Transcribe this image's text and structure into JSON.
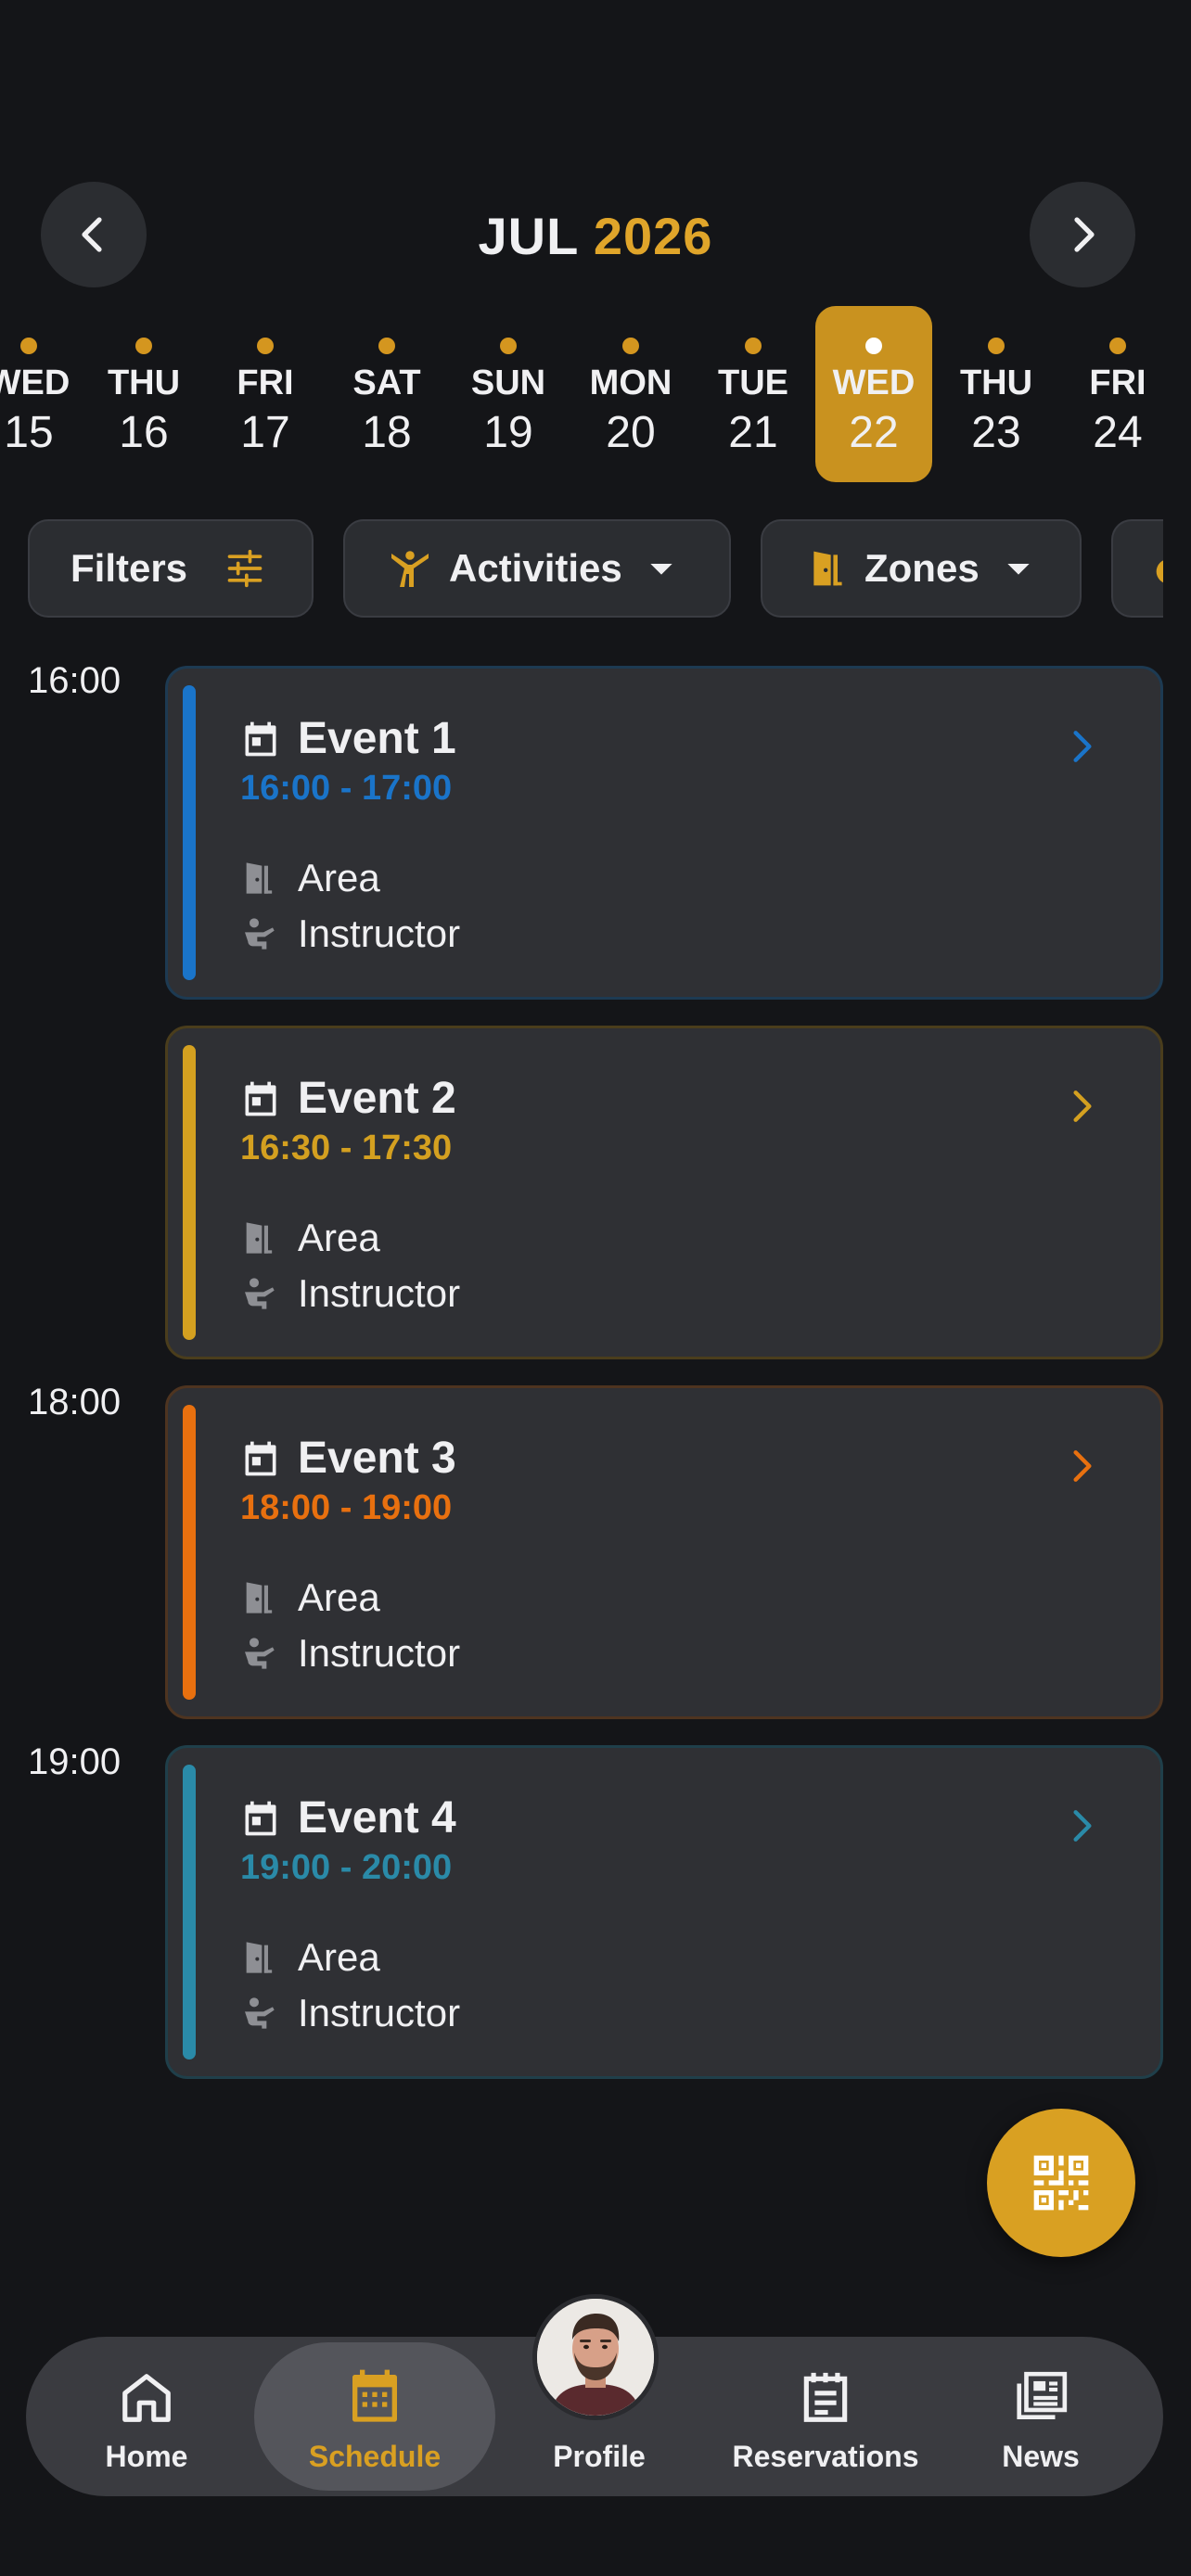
{
  "header": {
    "month": "JUL",
    "year": "2026",
    "prev_icon": "chevron-left-icon",
    "next_icon": "chevron-right-icon"
  },
  "days": [
    {
      "name": "WED",
      "num": "15"
    },
    {
      "name": "THU",
      "num": "16"
    },
    {
      "name": "FRI",
      "num": "17"
    },
    {
      "name": "SAT",
      "num": "18"
    },
    {
      "name": "SUN",
      "num": "19"
    },
    {
      "name": "MON",
      "num": "20"
    },
    {
      "name": "TUE",
      "num": "21"
    },
    {
      "name": "WED",
      "num": "22",
      "selected": true
    },
    {
      "name": "THU",
      "num": "23"
    },
    {
      "name": "FRI",
      "num": "24"
    }
  ],
  "filters": {
    "filters_label": "Filters",
    "activities_label": "Activities",
    "zones_label": "Zones"
  },
  "time_labels": [
    "16:00",
    "18:00",
    "19:00"
  ],
  "events": [
    {
      "title": "Event 1",
      "time": "16:00 - 17:00",
      "area": "Area",
      "instructor": "Instructor",
      "color": "#1a74c9"
    },
    {
      "title": "Event 2",
      "time": "16:30 - 17:30",
      "area": "Area",
      "instructor": "Instructor",
      "color": "#d4a020"
    },
    {
      "title": "Event 3",
      "time": "18:00 - 19:00",
      "area": "Area",
      "instructor": "Instructor",
      "color": "#e8700f"
    },
    {
      "title": "Event 4",
      "time": "19:00 - 20:00",
      "area": "Area",
      "instructor": "Instructor",
      "color": "#2a8aa8"
    }
  ],
  "fab": {
    "icon": "qr-code-icon"
  },
  "bottom_nav": {
    "home": "Home",
    "schedule": "Schedule",
    "profile": "Profile",
    "reservations": "Reservations",
    "news": "News"
  },
  "colors": {
    "accent": "#d9a022",
    "background": "#141518",
    "card": "#2f3034"
  }
}
